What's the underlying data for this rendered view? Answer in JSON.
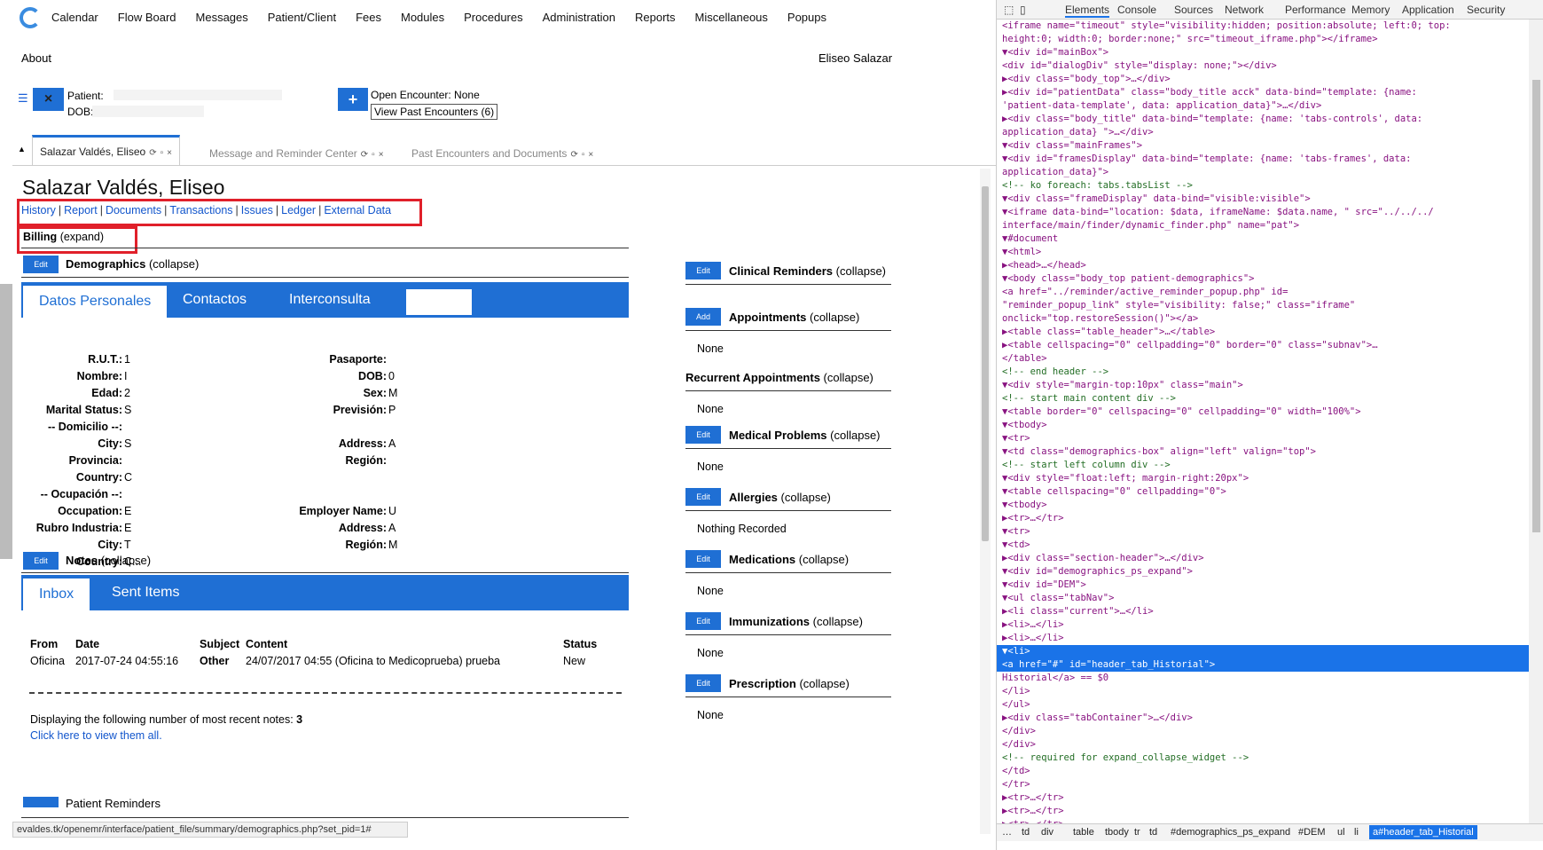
{
  "menu": [
    "Calendar",
    "Flow Board",
    "Messages",
    "Patient/Client",
    "Fees",
    "Modules",
    "Procedures",
    "Administration",
    "Reports",
    "Miscellaneous",
    "Popups"
  ],
  "about": "About",
  "user": "Eliseo Salazar",
  "patient_bar": {
    "close_icon": "×",
    "patient_label": "Patient:",
    "dob_label": "DOB:",
    "add_icon": "+",
    "open_encounter": "Open Encounter: None",
    "past_encounters": "View Past Encounters (6)"
  },
  "tabs": [
    {
      "label": "Salazar Valdés, Eliseo"
    },
    {
      "label": "Message and Reminder Center"
    },
    {
      "label": "Past Encounters and Documents"
    }
  ],
  "tab_icons": {
    "refresh": "⟳",
    "lock": "🔓",
    "close": "×",
    "arrow": "▲"
  },
  "page": {
    "patient_name": "Salazar Valdés, Eliseo",
    "nav": [
      "History",
      "Report",
      "Documents",
      "Transactions",
      "Issues",
      "Ledger",
      "External Data"
    ],
    "billing": "Billing",
    "billing_expand": "(expand)",
    "edit": "Edit",
    "add": "Add",
    "demographics": "Demographics",
    "collapse": "(collapse)",
    "demo_tabs": [
      "Datos Personales",
      "Contactos",
      "Interconsulta"
    ],
    "left_fields": [
      {
        "label": "R.U.T.:",
        "value": "1"
      },
      {
        "label": "Nombre:",
        "value": "I"
      },
      {
        "label": "Edad:",
        "value": "2"
      },
      {
        "label": "Marital Status:",
        "value": "S"
      },
      {
        "label": "-- Domicilio --:",
        "value": ""
      },
      {
        "label": "City:",
        "value": "S"
      },
      {
        "label": "Provincia:",
        "value": ""
      },
      {
        "label": "Country:",
        "value": "C"
      },
      {
        "label": "-- Ocupación --:",
        "value": ""
      },
      {
        "label": "Occupation:",
        "value": "E"
      },
      {
        "label": "Rubro Industria:",
        "value": "E"
      },
      {
        "label": "City:",
        "value": "T"
      },
      {
        "label": "Country:",
        "value": "C..."
      }
    ],
    "right_fields": [
      {
        "label": "Pasaporte:",
        "value": ""
      },
      {
        "label": "DOB:",
        "value": "0"
      },
      {
        "label": "Sex:",
        "value": "M"
      },
      {
        "label": "Previsión:",
        "value": "P"
      },
      {
        "label": "Address:",
        "value": "A"
      },
      {
        "label": "Región:",
        "value": ""
      },
      {
        "label": "Employer Name:",
        "value": "U"
      },
      {
        "label": "Address:",
        "value": "A"
      },
      {
        "label": "Región:",
        "value": "M"
      }
    ],
    "notes": "Notes",
    "notes_tabs": [
      "Inbox",
      "Sent Items"
    ],
    "notes_headers": [
      "From",
      "Date",
      "Subject",
      "Content",
      "Status"
    ],
    "notes_row": {
      "from": "Oficina",
      "date": "2017-07-24 04:55:16",
      "subject": "Other",
      "content": "24/07/2017 04:55 (Oficina to Medicoprueba) prueba",
      "status": "New"
    },
    "notes_count_text": "Displaying the following number of most recent notes:",
    "notes_count": "3",
    "notes_link": "Click here to view them all.",
    "patient_reminders": "Patient Reminders",
    "status_url": "evaldes.tk/openemr/interface/patient_file/summary/demographics.php?set_pid=1#"
  },
  "right_sections": [
    {
      "btn": "Edit",
      "title": "Clinical Reminders",
      "value": ""
    },
    {
      "btn": "Add",
      "title": "Appointments",
      "value": "None"
    },
    {
      "btn": "",
      "title": "Recurrent Appointments",
      "value": "None"
    },
    {
      "btn": "Edit",
      "title": "Medical Problems",
      "value": "None"
    },
    {
      "btn": "Edit",
      "title": "Allergies",
      "value": "Nothing Recorded"
    },
    {
      "btn": "Edit",
      "title": "Medications",
      "value": "None"
    },
    {
      "btn": "Edit",
      "title": "Immunizations",
      "value": "None"
    },
    {
      "btn": "Edit",
      "title": "Prescription",
      "value": "None"
    }
  ],
  "devtools": {
    "tabs": [
      "Elements",
      "Console",
      "Sources",
      "Network",
      "Performance",
      "Memory",
      "Application",
      "Security"
    ],
    "lines": [
      "<iframe name=\"timeout\" style=\"visibility:hidden; position:absolute; left:0; top:",
      "height:0; width:0; border:none;\" src=\"timeout_iframe.php\"></iframe>",
      "▼<div id=\"mainBox\">",
      "  <div id=\"dialogDiv\" style=\"display: none;\"></div>",
      " ▶<div class=\"body_top\">…</div>",
      " ▶<div id=\"patientData\" class=\"body_title acck\" data-bind=\"template: {name:",
      "  'patient-data-template', data: application_data}\">…</div>",
      " ▶<div class=\"body_title\" data-bind=\"template: {name: 'tabs-controls', data:",
      "  application_data} \">…</div>",
      " ▼<div class=\"mainFrames\">",
      "  ▼<div id=\"framesDisplay\" data-bind=\"template: {name: 'tabs-frames', data:",
      "    application_data}\">",
      "     <!-- ko  foreach: tabs.tabsList -->",
      "    ▼<div class=\"frameDisplay\" data-bind=\"visible:visible\">",
      "      ▼<iframe data-bind=\"location: $data, iframeName: $data.name, \" src=\"../../../",
      "        interface/main/finder/dynamic_finder.php\" name=\"pat\">",
      "        ▼#document",
      "         ▼<html>",
      "          ▶<head>…</head>",
      "          ▼<body class=\"body_top patient-demographics\">",
      "             <a href=\"../reminder/active_reminder_popup.php\" id=",
      "             \"reminder_popup_link\" style=\"visibility: false;\" class=\"iframe\"",
      "             onclick=\"top.restoreSession()\"></a>",
      "           ▶<table class=\"table_header\">…</table>",
      "           ▶<table cellspacing=\"0\" cellpadding=\"0\" border=\"0\" class=\"subnav\">…",
      "            </table>",
      "             <!-- end header -->",
      "           ▼<div style=\"margin-top:10px\" class=\"main\">",
      "               <!-- start main content div -->",
      "             ▼<table border=\"0\" cellspacing=\"0\" cellpadding=\"0\" width=\"100%\">",
      "               ▼<tbody>",
      "                 ▼<tr>",
      "                   ▼<td class=\"demographics-box\" align=\"left\" valign=\"top\">",
      "                       <!-- start left column div -->",
      "                     ▼<div style=\"float:left; margin-right:20px\">",
      "                       ▼<table cellspacing=\"0\" cellpadding=\"0\">",
      "                         ▼<tbody>",
      "                           ▶<tr>…</tr>",
      "                           ▼<tr>",
      "                             ▼<td>",
      "                               ▶<div class=\"section-header\">…</div>",
      "                               ▼<div id=\"demographics_ps_expand\">",
      "                                 ▼<div id=\"DEM\">",
      "                                   ▼<ul class=\"tabNav\">",
      "                                     ▶<li class=\"current\">…</li>",
      "                                     ▶<li>…</li>",
      "                                     ▶<li>…</li>",
      "                                     ▼<li>",
      "                                          <a href=\"#\" id=\"header_tab_Historial\">",
      "                                          Historial</a> == $0",
      "                                        </li>",
      "                                     </ul>",
      "                                   ▶<div class=\"tabContainer\">…</div>",
      "                                   </div>",
      "                                 </div>",
      "                                 <!-- required for expand_collapse_widget -->",
      "                               </td>",
      "                             </tr>",
      "                           ▶<tr>…</tr>",
      "                           ▶<tr>…</tr>",
      "                           ▶<tr>…</tr>"
    ],
    "breadcrumbs": [
      "…",
      "td",
      "div",
      "table",
      "tbody",
      "tr",
      "td",
      "#demographics_ps_expand",
      "#DEM",
      "ul",
      "li",
      "a#header_tab_Historial"
    ]
  },
  "colors": {
    "accent": "#1f6fd4",
    "highlight": "#e0202a",
    "link": "#1155cc"
  }
}
